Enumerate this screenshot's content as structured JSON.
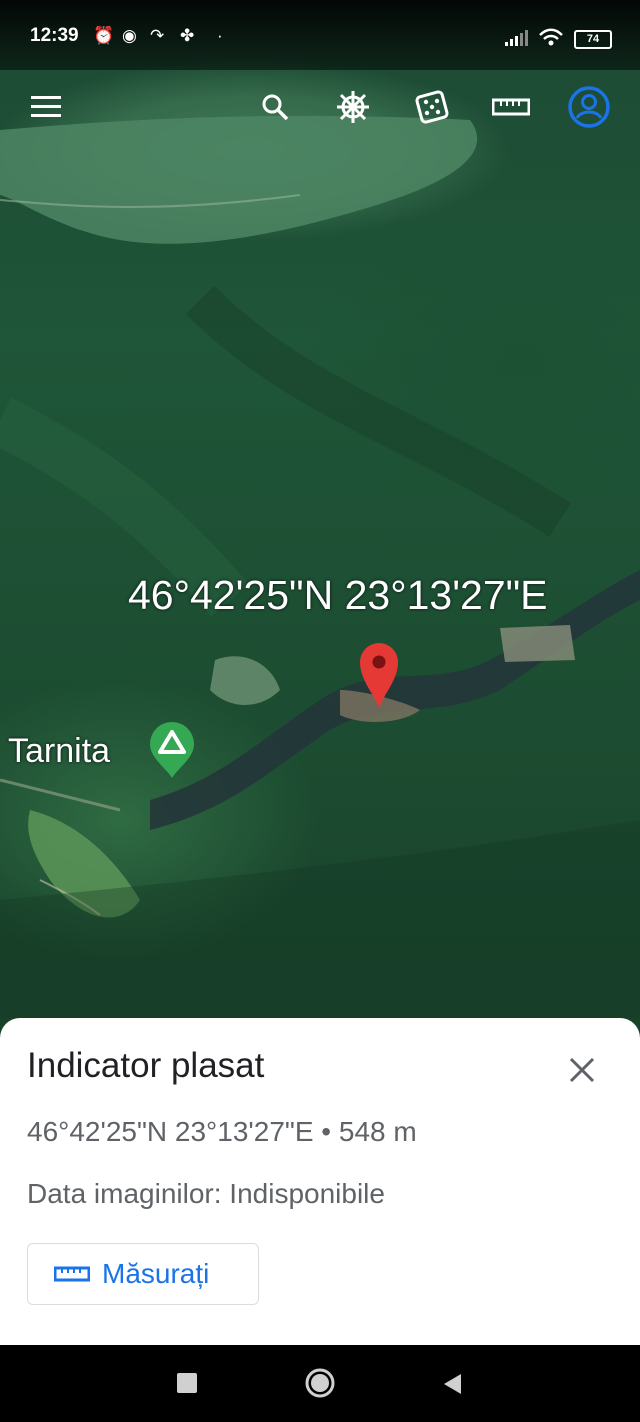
{
  "status_bar": {
    "time": "12:39",
    "battery": "74"
  },
  "toolbar": {
    "icons": [
      "menu-icon",
      "search-icon",
      "voyager-wheel-icon",
      "dice-icon",
      "ruler-icon",
      "account-icon"
    ]
  },
  "map": {
    "coordinate_label": "46°42'25\"N 23°13'27\"E",
    "place_label": "Tarnita",
    "pin_color": "#e53935",
    "place_marker_color": "#34a853"
  },
  "sheet": {
    "title": "Indicator plasat",
    "coordinates_line": "46°42'25\"N 23°13'27\"E • 548 m",
    "imagery_date": "Data imaginilor: Indisponibile",
    "measure_label": "Măsurați"
  },
  "colors": {
    "accent": "#1a73e8"
  }
}
